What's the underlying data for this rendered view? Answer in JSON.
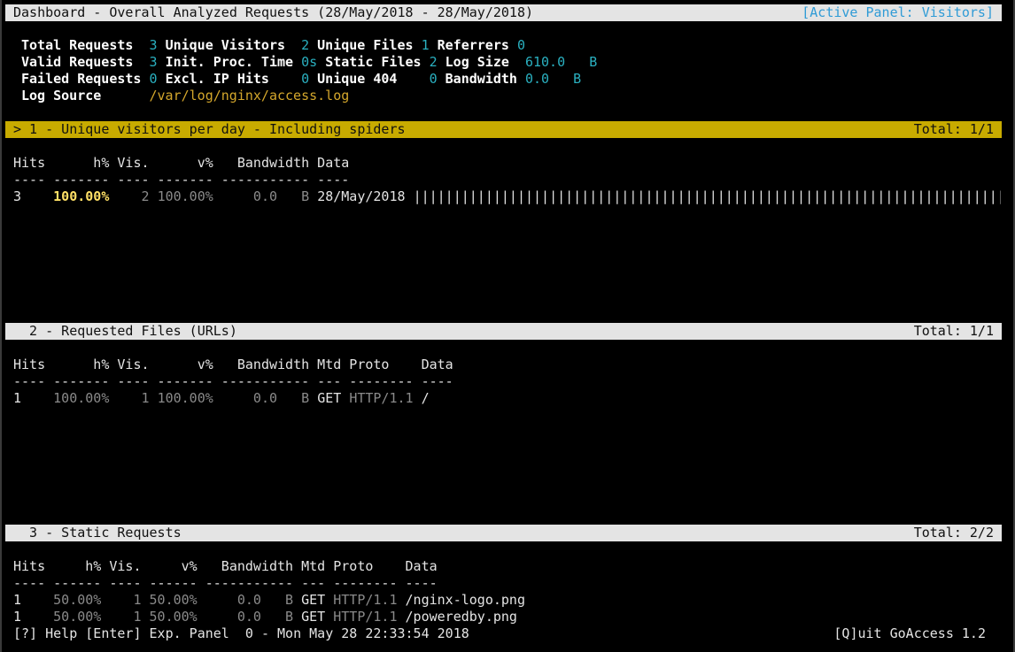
{
  "dashboard": {
    "title": "Dashboard - Overall Analyzed Requests (28/May/2018 - 28/May/2018)",
    "active_panel": "[Active Panel: Visitors]"
  },
  "overview": {
    "total_requests_label": "Total Requests",
    "total_requests": "3",
    "unique_visitors_label": "Unique Visitors",
    "unique_visitors": "2",
    "unique_files_label": "Unique Files",
    "unique_files": "1",
    "referrers_label": "Referrers",
    "referrers": "0",
    "valid_requests_label": "Valid Requests",
    "valid_requests": "3",
    "init_proc_label": "Init. Proc. Time",
    "init_proc": "0s",
    "static_files_label": "Static Files",
    "static_files": "2",
    "log_size_label": "Log Size",
    "log_size": "610.0   B",
    "failed_requests_label": "Failed Requests",
    "failed_requests": "0",
    "excl_ip_label": "Excl. IP Hits",
    "excl_ip": "0",
    "unique_404_label": "Unique 404",
    "unique_404": "0",
    "bandwidth_label": "Bandwidth",
    "bandwidth": "0.0   B",
    "log_source_label": "Log Source",
    "log_source": "/var/log/nginx/access.log"
  },
  "panel1": {
    "title": "> 1 - Unique visitors per day - Including spiders",
    "total": "Total: 1/1",
    "header": "Hits      h% Vis.      v%   Bandwidth Data",
    "divider": "---- ------- ---- ------- ----------- ----",
    "row": {
      "hits": "3    ",
      "hpct": "100.00%",
      "vis": "    2 ",
      "vpct": "100.00%",
      "bw": "     0.0   B ",
      "data": "28/May/2018 ",
      "bar": "||||||||||||||||||||||||||||||||||||||||||||||||||||||||||||||||||||||||||||||||||||||||||||||||||||||||||||||||||||||||||||||"
    }
  },
  "panel2": {
    "title": "  2 - Requested Files (URLs)",
    "total": "Total: 1/1",
    "header": "Hits      h% Vis.      v%   Bandwidth Mtd Proto    Data",
    "divider": "---- ------- ---- ------- ----------- --- -------- ----",
    "row": {
      "hits": "1    ",
      "hpct": "100.00%",
      "vis": "    1 ",
      "vpct": "100.00%",
      "bw": "     0.0   B ",
      "mtd": "GET ",
      "proto": "HTTP/1.1",
      "data": " /"
    }
  },
  "panel3": {
    "title": "  3 - Static Requests",
    "total": "Total: 2/2",
    "header": "Hits     h% Vis.     v%   Bandwidth Mtd Proto    Data",
    "divider": "---- ------ ---- ------ ----------- --- -------- ----",
    "rows": [
      {
        "hits": "1    ",
        "hpct": "50.00%",
        "vis": "    1 ",
        "vpct": "50.00%",
        "bw": "     0.0   B ",
        "mtd": "GET ",
        "proto": "HTTP/1.1",
        "data": " /nginx-logo.png"
      },
      {
        "hits": "1    ",
        "hpct": "50.00%",
        "vis": "    1 ",
        "vpct": "50.00%",
        "bw": "     0.0   B ",
        "mtd": "GET ",
        "proto": "HTTP/1.1",
        "data": " /poweredby.png"
      }
    ]
  },
  "footer": {
    "left": "[?] Help [Enter] Exp. Panel  0 - Mon May 28 22:33:54 2018",
    "right": "[Q]uit GoAccess 1.2"
  }
}
